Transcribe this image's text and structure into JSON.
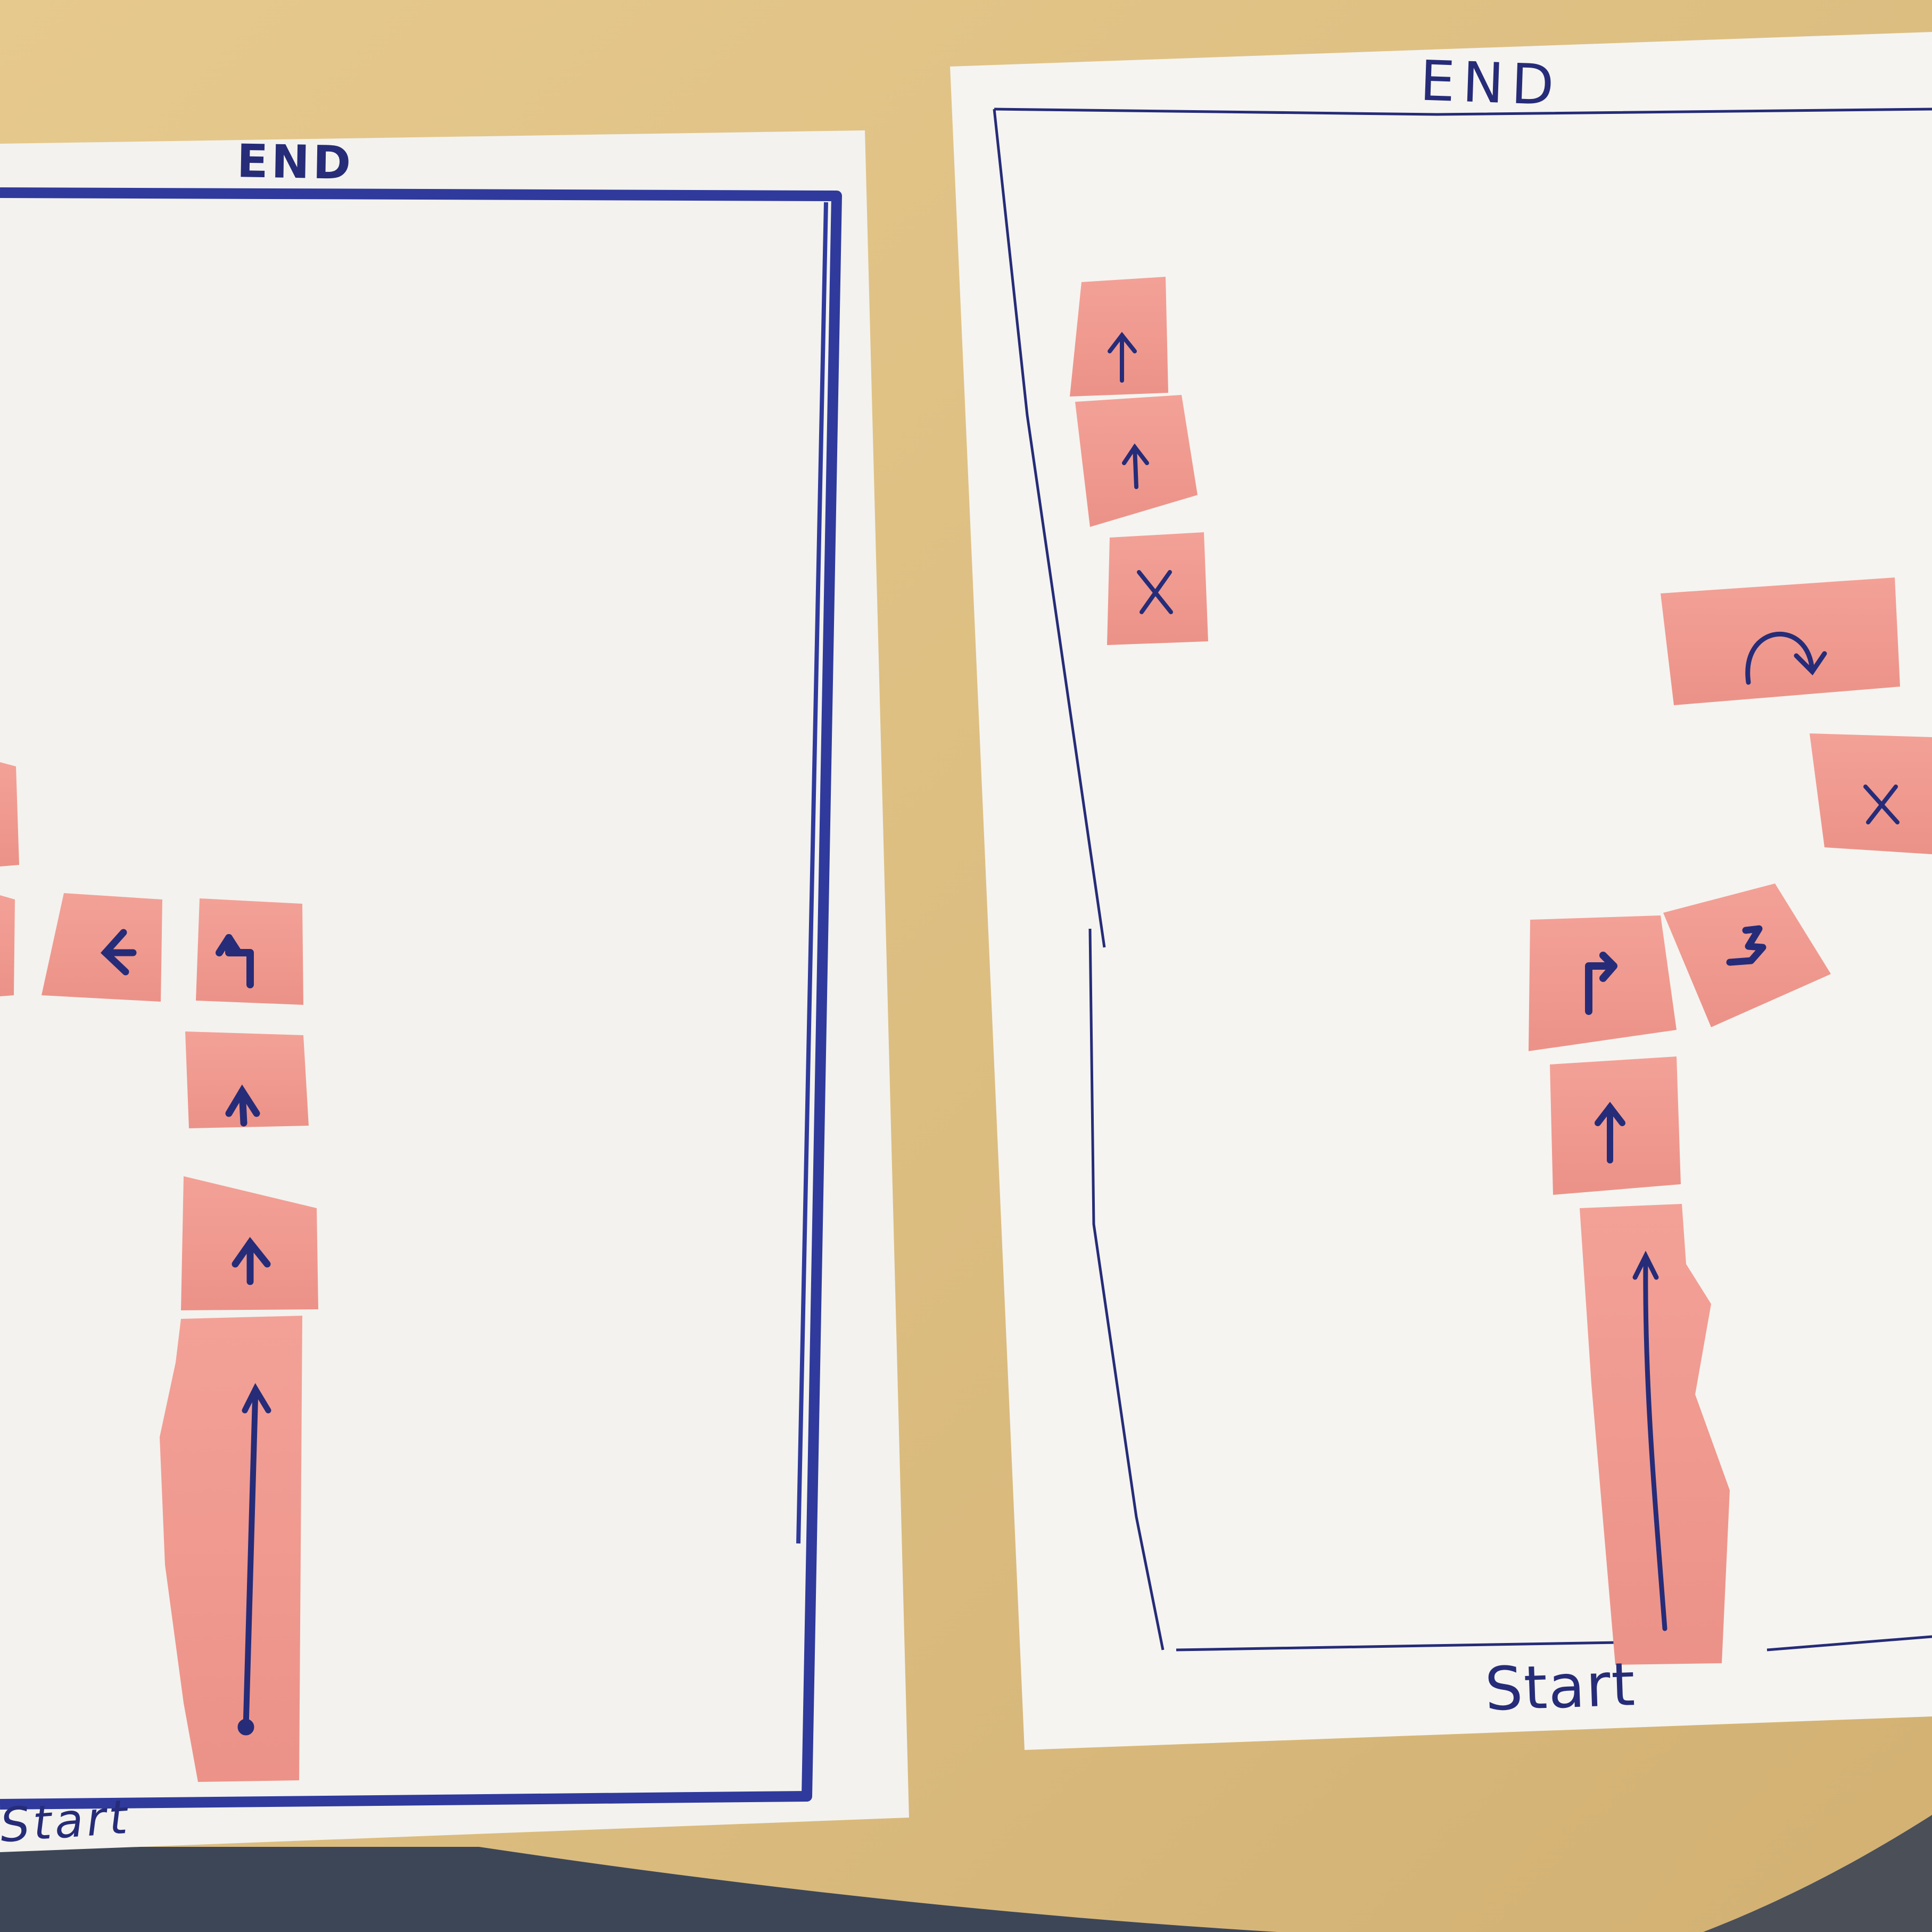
{
  "colors": {
    "table": "#dcbf84",
    "paper": "#f4f3ef",
    "sticky_note": "#f09a90",
    "ink": "#262c78",
    "marker_border": "#2f3a9c"
  },
  "left_sheet": {
    "end_label": "END",
    "start_label": "Start",
    "notes": [
      {
        "symbol": "long-up-arrow-icon"
      },
      {
        "symbol": "up-arrow-icon"
      },
      {
        "symbol": "up-arrow-icon"
      },
      {
        "symbol": "turn-left-arrow-icon"
      },
      {
        "symbol": "left-arrow-icon"
      },
      {
        "symbol": "partial-note"
      },
      {
        "symbol": "partial-note"
      }
    ]
  },
  "right_sheet": {
    "end_label": "END",
    "start_label": "Start",
    "notes": [
      {
        "symbol": "long-up-arrow-icon"
      },
      {
        "symbol": "up-arrow-icon"
      },
      {
        "symbol": "turn-right-arrow-icon"
      },
      {
        "symbol": "zigzag-arrow-icon"
      },
      {
        "symbol": "x-mark-icon"
      },
      {
        "symbol": "curved-arrow-icon"
      },
      {
        "symbol": "x-mark-icon"
      },
      {
        "symbol": "up-arrow-icon"
      },
      {
        "symbol": "up-arrow-icon"
      }
    ]
  }
}
